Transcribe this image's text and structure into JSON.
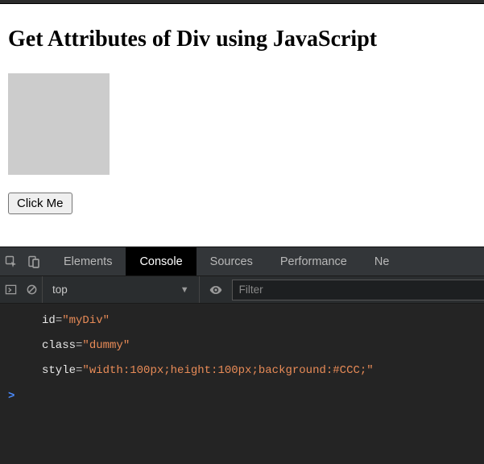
{
  "page": {
    "heading": "Get Attributes of Div using JavaScript",
    "button_label": "Click Me"
  },
  "devtools": {
    "tabs": [
      "Elements",
      "Console",
      "Sources",
      "Performance",
      "Ne"
    ],
    "active_tab": "Console",
    "context": "top",
    "filter_placeholder": "Filter",
    "prompt": ">",
    "log_output": [
      {
        "attr": "id",
        "value": "myDiv"
      },
      {
        "attr": "class",
        "value": "dummy"
      },
      {
        "attr": "style",
        "value": "width:100px;height:100px;background:#CCC;"
      }
    ]
  }
}
